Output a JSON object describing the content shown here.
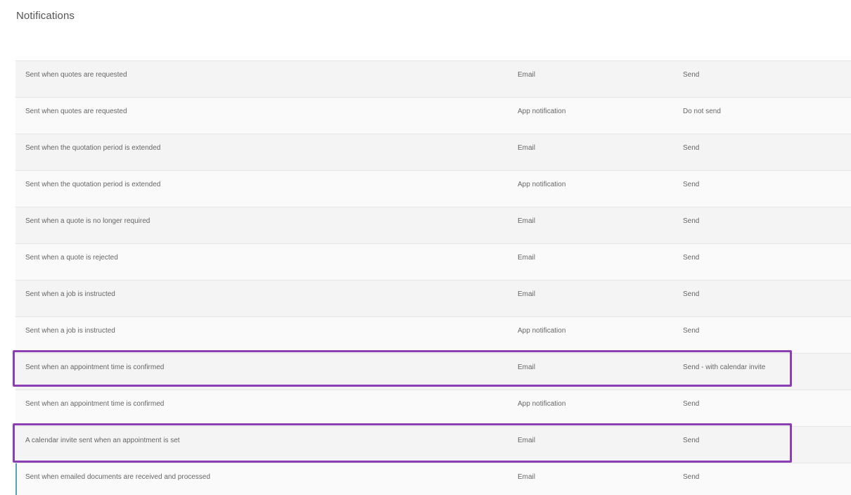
{
  "page": {
    "title": "Notifications"
  },
  "colors": {
    "highlight_border": "#8a3fb5",
    "accent_left_border": "#4fa3b8"
  },
  "notifications": [
    {
      "description": "Sent when quotes are requested",
      "channel": "Email",
      "action": "Send",
      "highlighted": false
    },
    {
      "description": "Sent when quotes are requested",
      "channel": "App notification",
      "action": "Do not send",
      "highlighted": false
    },
    {
      "description": "Sent when the quotation period is extended",
      "channel": "Email",
      "action": "Send",
      "highlighted": false
    },
    {
      "description": "Sent when the quotation period is extended",
      "channel": "App notification",
      "action": "Send",
      "highlighted": false
    },
    {
      "description": "Sent when a quote is no longer required",
      "channel": "Email",
      "action": "Send",
      "highlighted": false
    },
    {
      "description": "Sent when a quote is rejected",
      "channel": "Email",
      "action": "Send",
      "highlighted": false
    },
    {
      "description": "Sent when a job is instructed",
      "channel": "Email",
      "action": "Send",
      "highlighted": false
    },
    {
      "description": "Sent when a job is instructed",
      "channel": "App notification",
      "action": "Send",
      "highlighted": false
    },
    {
      "description": "Sent when an appointment time is confirmed",
      "channel": "Email",
      "action": "Send - with calendar invite",
      "highlighted": true
    },
    {
      "description": "Sent when an appointment time is confirmed",
      "channel": "App notification",
      "action": "Send",
      "highlighted": false
    },
    {
      "description": "A calendar invite sent when an appointment is set",
      "channel": "Email",
      "action": "Send",
      "highlighted": true
    },
    {
      "description": "Sent when emailed documents are received and processed",
      "channel": "Email",
      "action": "Send",
      "highlighted": false
    }
  ]
}
